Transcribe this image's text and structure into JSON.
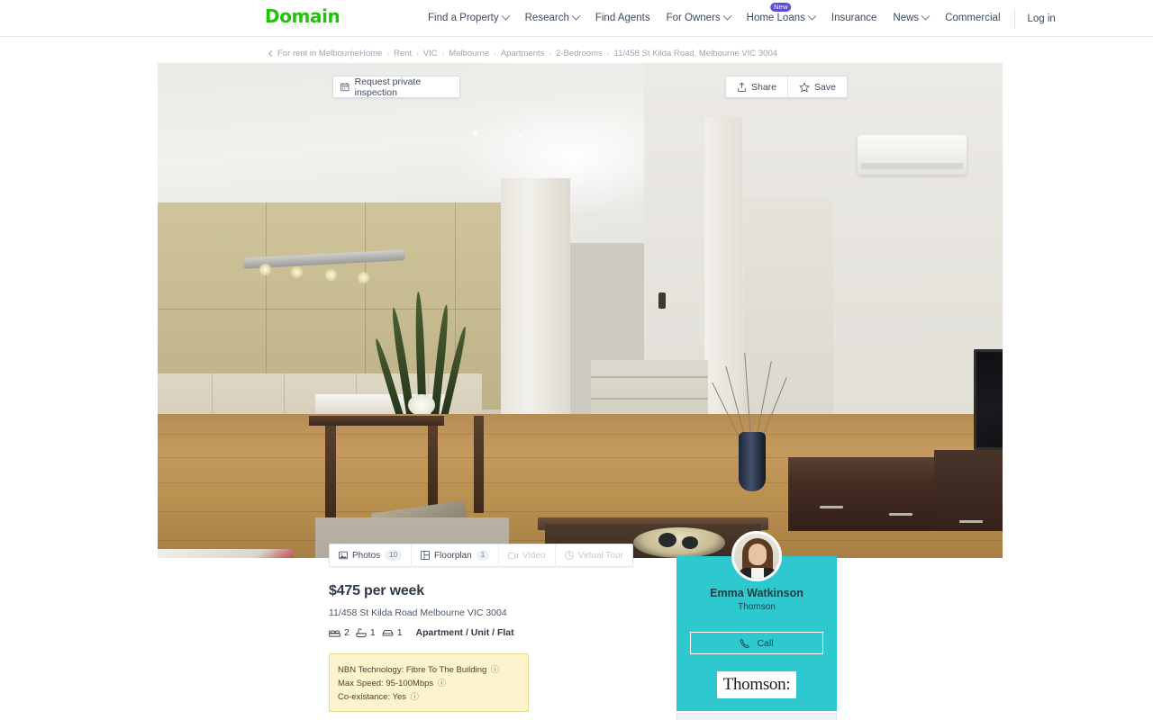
{
  "brand": {
    "logo_text": "Domain",
    "logo_color": "#23c10c"
  },
  "header": {
    "nav_items": [
      {
        "label": "Find a Property",
        "has_caret": true,
        "badge": null
      },
      {
        "label": "Research",
        "has_caret": true,
        "badge": null
      },
      {
        "label": "Find Agents",
        "has_caret": false,
        "badge": null
      },
      {
        "label": "For Owners",
        "has_caret": true,
        "badge": null
      },
      {
        "label": "Home Loans",
        "has_caret": true,
        "badge": "New"
      },
      {
        "label": "Insurance",
        "has_caret": false,
        "badge": null
      },
      {
        "label": "News",
        "has_caret": true,
        "badge": null
      },
      {
        "label": "Commercial",
        "has_caret": false,
        "badge": null
      }
    ],
    "login_label": "Log in"
  },
  "breadcrumb": {
    "back_label": "For rent in Melbourne",
    "items": [
      "Home",
      "Rent",
      "VIC",
      "Melbourne",
      "Apartments",
      "2-Bedrooms",
      "11/458 St Kilda Road, Melbourne VIC 3004"
    ],
    "separator": "›"
  },
  "hero": {
    "request_inspection_label": "Request private inspection",
    "share_label": "Share",
    "save_label": "Save"
  },
  "media_tabs": [
    {
      "label": "Photos",
      "count": "10",
      "enabled": true
    },
    {
      "label": "Floorplan",
      "count": "1",
      "enabled": true
    },
    {
      "label": "Video",
      "count": null,
      "enabled": false
    },
    {
      "label": "Virtual Tour",
      "count": null,
      "enabled": false
    }
  ],
  "listing": {
    "price": "$475 per week",
    "address": "11/458 St Kilda Road Melbourne VIC 3004",
    "beds": "2",
    "baths": "1",
    "parking": "1",
    "property_type": "Apartment / Unit / Flat"
  },
  "nbn": {
    "technology": "NBN Technology: Fibre To The Building",
    "max_speed": "Max Speed: 95-100Mbps",
    "co_existance": "Co-existance: Yes",
    "info_glyph": "ⓘ"
  },
  "agent": {
    "name": "Emma Watkinson",
    "agency": "Thomson",
    "call_label": "Call",
    "agency_logo_text": "Thomson:",
    "card_color": "#2ec9cf"
  }
}
